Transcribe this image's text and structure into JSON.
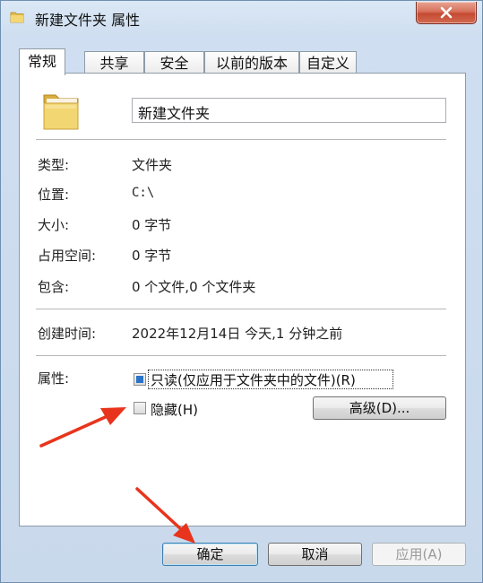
{
  "window": {
    "title": "新建文件夹 属性",
    "close_icon": "close-icon"
  },
  "tabs": [
    {
      "label": "常规",
      "active": true
    },
    {
      "label": "共享",
      "active": false
    },
    {
      "label": "安全",
      "active": false
    },
    {
      "label": "以前的版本",
      "active": false
    },
    {
      "label": "自定义",
      "active": false
    }
  ],
  "general": {
    "folder_name": "新建文件夹",
    "type_label": "类型:",
    "type_value": "文件夹",
    "location_label": "位置:",
    "location_value": "C:\\",
    "size_label": "大小:",
    "size_value": "0 字节",
    "disk_label": "占用空间:",
    "disk_value": "0 字节",
    "contains_label": "包含:",
    "contains_value": "0 个文件,0 个文件夹",
    "created_label": "创建时间:",
    "created_value": "2022年12月14日 今天,1 分钟之前",
    "attributes_label": "属性:",
    "readonly_label": "只读(仅应用于文件夹中的文件)(R)",
    "readonly_state": "indeterminate",
    "hidden_label": "隐藏(H)",
    "hidden_state": "unchecked",
    "advanced_label": "高级(D)..."
  },
  "footer": {
    "ok_label": "确定",
    "cancel_label": "取消",
    "apply_label": "应用(A)"
  },
  "colors": {
    "annotation_arrow": "#e8341c",
    "checkbox_fill": "#2a74c8",
    "folder": "#e9c865"
  }
}
